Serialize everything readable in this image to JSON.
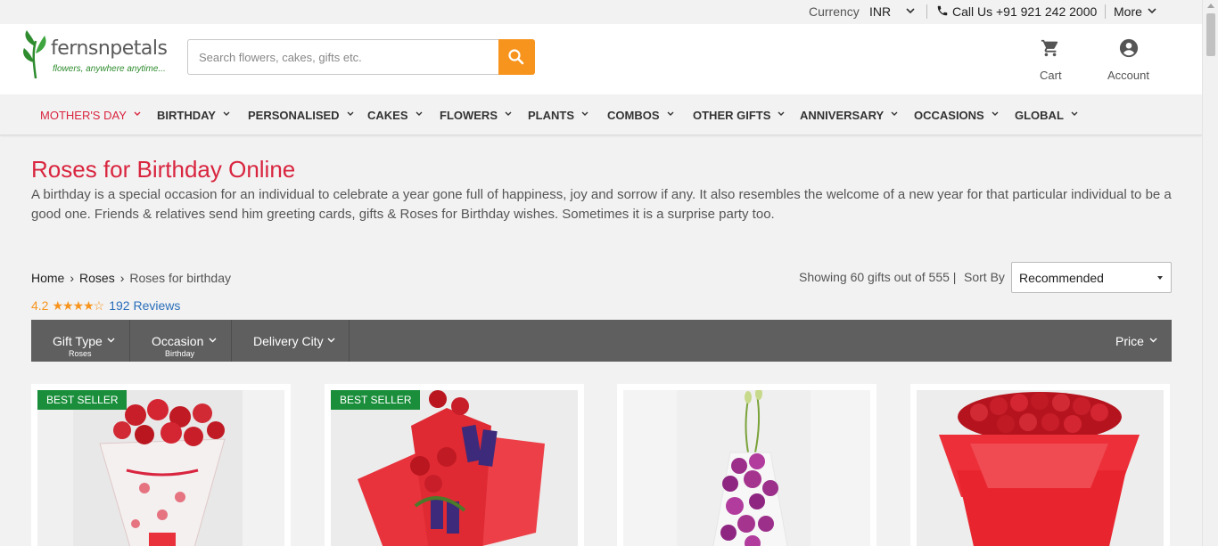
{
  "topbar": {
    "currency_label": "Currency",
    "currency_value": "INR",
    "call_text": "Call Us +91 921 242 2000",
    "more_label": "More"
  },
  "header": {
    "logo_word": "fernsnpetals",
    "logo_tagline": "flowers, anywhere anytime...",
    "search_placeholder": "Search flowers, cakes, gifts etc.",
    "cart_label": "Cart",
    "account_label": "Account"
  },
  "nav": {
    "items": [
      {
        "label": "MOTHER'S DAY"
      },
      {
        "label": "BIRTHDAY"
      },
      {
        "label": "PERSONALISED"
      },
      {
        "label": "CAKES"
      },
      {
        "label": "FLOWERS"
      },
      {
        "label": "PLANTS"
      },
      {
        "label": "COMBOS"
      },
      {
        "label": "OTHER GIFTS"
      },
      {
        "label": "ANNIVERSARY"
      },
      {
        "label": "OCCASIONS"
      },
      {
        "label": "GLOBAL"
      }
    ]
  },
  "page": {
    "title": "Roses for Birthday Online",
    "description": "A birthday is a special occasion for an individual to celebrate a year gone full of happiness, joy and sorrow if any. It also resembles the welcome of a new year for that particular individual to be a good one. Friends & relatives send him greeting cards, gifts & Roses for Birthday wishes. Sometimes it is a surprise party too."
  },
  "breadcrumb": [
    "Home",
    "Roses",
    "Roses for birthday"
  ],
  "rating": {
    "value": "4.2",
    "stars": "★★★★☆",
    "count": "192",
    "reviews_label": "Reviews"
  },
  "listing": {
    "showing_text": "Showing 60 gifts out of 555 |",
    "sort_label": "Sort By",
    "sort_value": "Recommended"
  },
  "filters": [
    {
      "label": "Gift Type",
      "sub": "Roses"
    },
    {
      "label": "Occasion",
      "sub": "Birthday"
    },
    {
      "label": "Delivery City",
      "sub": ""
    },
    {
      "label": "Price",
      "sub": ""
    }
  ],
  "products": [
    {
      "badge": "BEST SELLER"
    },
    {
      "badge": "BEST SELLER"
    },
    {
      "badge": ""
    },
    {
      "badge": ""
    }
  ],
  "colors": {
    "brand_red": "#d9253f",
    "search_orange": "#f7941d",
    "badge_green": "#1a8e3b",
    "filter_gray": "#5f5f5f",
    "link_blue": "#2a6ebb"
  }
}
